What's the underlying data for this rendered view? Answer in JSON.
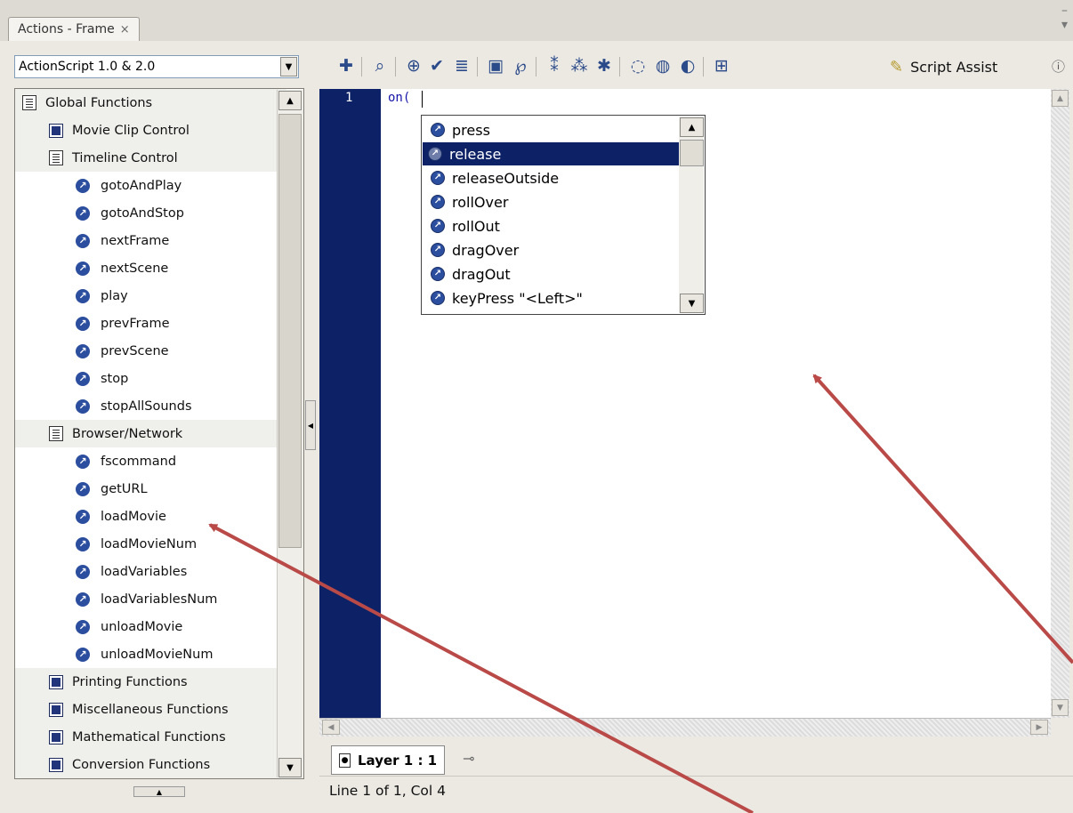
{
  "window": {
    "tab_title": "Actions - Frame",
    "tab_close": "×"
  },
  "left_panel": {
    "version_select": "ActionScript 1.0 & 2.0",
    "tree": [
      {
        "label": "Global Functions",
        "kind": "book",
        "level": 0
      },
      {
        "label": "Movie Clip Control",
        "kind": "category",
        "level": 1
      },
      {
        "label": "Timeline Control",
        "kind": "book",
        "level": 1
      },
      {
        "label": "gotoAndPlay",
        "kind": "function",
        "level": 2
      },
      {
        "label": "gotoAndStop",
        "kind": "function",
        "level": 2
      },
      {
        "label": "nextFrame",
        "kind": "function",
        "level": 2
      },
      {
        "label": "nextScene",
        "kind": "function",
        "level": 2
      },
      {
        "label": "play",
        "kind": "function",
        "level": 2
      },
      {
        "label": "prevFrame",
        "kind": "function",
        "level": 2
      },
      {
        "label": "prevScene",
        "kind": "function",
        "level": 2
      },
      {
        "label": "stop",
        "kind": "function",
        "level": 2
      },
      {
        "label": "stopAllSounds",
        "kind": "function",
        "level": 2
      },
      {
        "label": "Browser/Network",
        "kind": "book",
        "level": 1
      },
      {
        "label": "fscommand",
        "kind": "function",
        "level": 2
      },
      {
        "label": "getURL",
        "kind": "function",
        "level": 2
      },
      {
        "label": "loadMovie",
        "kind": "function",
        "level": 2
      },
      {
        "label": "loadMovieNum",
        "kind": "function",
        "level": 2
      },
      {
        "label": "loadVariables",
        "kind": "function",
        "level": 2
      },
      {
        "label": "loadVariablesNum",
        "kind": "function",
        "level": 2
      },
      {
        "label": "unloadMovie",
        "kind": "function",
        "level": 2
      },
      {
        "label": "unloadMovieNum",
        "kind": "function",
        "level": 2
      },
      {
        "label": "Printing Functions",
        "kind": "category",
        "level": 1
      },
      {
        "label": "Miscellaneous Functions",
        "kind": "category",
        "level": 1
      },
      {
        "label": "Mathematical Functions",
        "kind": "category",
        "level": 1
      },
      {
        "label": "Conversion Functions",
        "kind": "category",
        "level": 1
      }
    ]
  },
  "toolbar": {
    "script_assist_label": "Script Assist",
    "icons": [
      "add-item-icon",
      "find-icon",
      "insert-target-path-icon",
      "check-syntax-icon",
      "auto-format-icon",
      "show-code-hint-icon",
      "debug-options-icon",
      "collapse-between-braces-icon",
      "collapse-selection-icon",
      "expand-all-icon",
      "apply-block-comment-icon",
      "apply-line-comment-icon",
      "remove-comment-icon",
      "show-hide-toolbox-icon"
    ]
  },
  "editor": {
    "line_number": "1",
    "code": "on(",
    "code_hints": [
      {
        "label": "press",
        "selected": false
      },
      {
        "label": "release",
        "selected": true
      },
      {
        "label": "releaseOutside",
        "selected": false
      },
      {
        "label": "rollOver",
        "selected": false
      },
      {
        "label": "rollOut",
        "selected": false
      },
      {
        "label": "dragOver",
        "selected": false
      },
      {
        "label": "dragOut",
        "selected": false
      },
      {
        "label": "keyPress \"<Left>\"",
        "selected": false
      }
    ]
  },
  "footer": {
    "layer_tab": "Layer 1 : 1",
    "status": "Line 1 of 1, Col 4"
  },
  "colors": {
    "gutter": "#0d2266",
    "selection": "#0d2266",
    "annotation_arrow": "#b94a48"
  }
}
